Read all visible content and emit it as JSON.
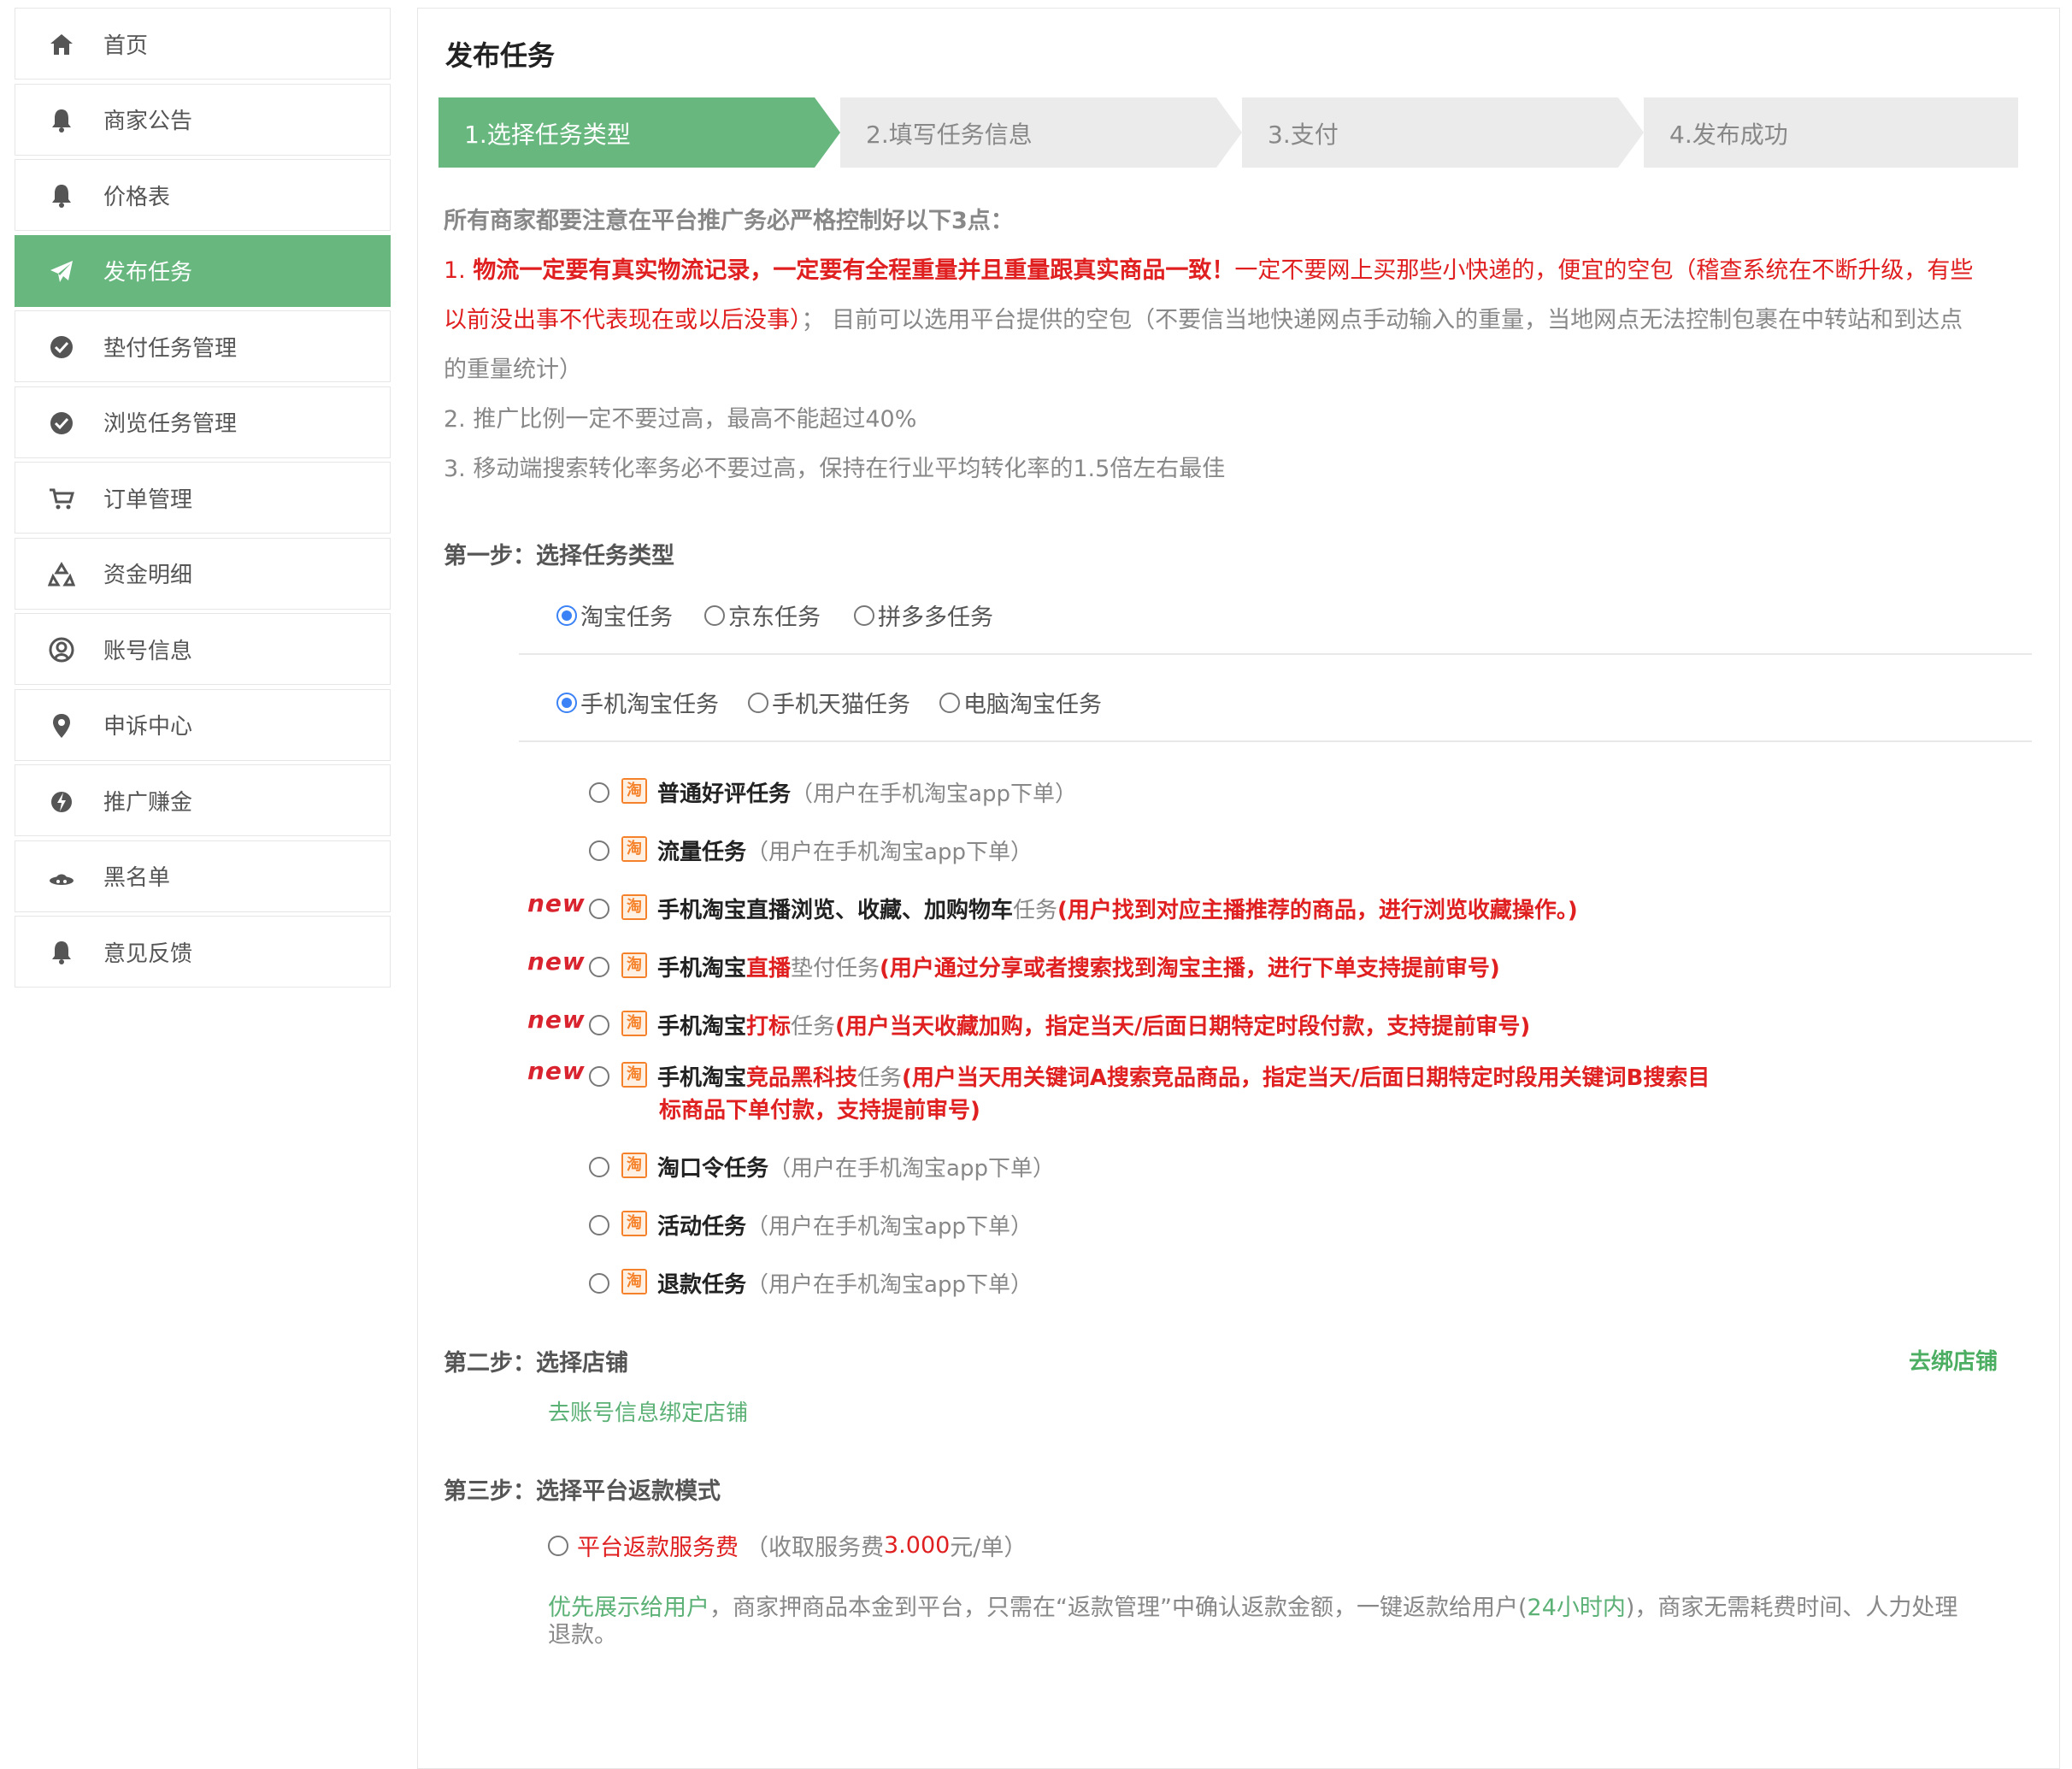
{
  "sidebar": {
    "items": [
      {
        "label": "首页",
        "icon": "home-icon",
        "active": false
      },
      {
        "label": "商家公告",
        "icon": "bell-icon",
        "active": false
      },
      {
        "label": "价格表",
        "icon": "bell-icon",
        "active": false
      },
      {
        "label": "发布任务",
        "icon": "paper-plane-icon",
        "active": true
      },
      {
        "label": "垫付任务管理",
        "icon": "check-circle-icon",
        "active": false
      },
      {
        "label": "浏览任务管理",
        "icon": "check-circle-icon",
        "active": false
      },
      {
        "label": "订单管理",
        "icon": "cart-icon",
        "active": false
      },
      {
        "label": "资金明细",
        "icon": "recycle-icon",
        "active": false
      },
      {
        "label": "账号信息",
        "icon": "user-circle-icon",
        "active": false
      },
      {
        "label": "申诉中心",
        "icon": "map-pin-icon",
        "active": false
      },
      {
        "label": "推广赚金",
        "icon": "bolt-icon",
        "active": false
      },
      {
        "label": "黑名单",
        "icon": "hat-icon",
        "active": false
      },
      {
        "label": "意见反馈",
        "icon": "bell-icon",
        "active": false
      }
    ]
  },
  "main": {
    "title": "发布任务",
    "steps": [
      {
        "label": "1.选择任务类型",
        "active": true
      },
      {
        "label": "2.填写任务信息",
        "active": false
      },
      {
        "label": "3.支付",
        "active": false
      },
      {
        "label": "4.发布成功",
        "active": false
      }
    ],
    "notice": {
      "heading": "所有商家都要注意在平台推广务必严格控制好以下3点：",
      "p1_num": "1. ",
      "p1_red_bold": "物流一定要有真实物流记录，一定要有全程重量并且重量跟真实商品一致！",
      "p1_red_a": "一定不要网上买那些小快递的，便宜的空包（稽查系统在不断升级，有些",
      "p1_red_b": "以前没出事不代表现在或以后没事）",
      "p1_grey_b": "；  目前可以选用平台提供的空包（不要信当地快递网点手动输入的重量，当地网点无法控制包裹在中转站和到达点",
      "p1_grey_c": "的重量统计）",
      "p2": "2. 推广比例一定不要过高，最高不能超过40%",
      "p3": "3. 移动端搜索转化率务必不要过高，保持在行业平均转化率的1.5倍左右最佳"
    },
    "step1": {
      "title": "第一步：选择任务类型",
      "platforms": [
        {
          "label": "淘宝任务",
          "checked": true
        },
        {
          "label": "京东任务",
          "checked": false
        },
        {
          "label": "拼多多任务",
          "checked": false
        }
      ],
      "subtypes": [
        {
          "label": "手机淘宝任务",
          "checked": true
        },
        {
          "label": "手机天猫任务",
          "checked": false
        },
        {
          "label": "电脑淘宝任务",
          "checked": false
        }
      ],
      "new_label": "new",
      "tasks": [
        {
          "name": "普通好评任务",
          "desc": "（用户在手机淘宝app下单）"
        },
        {
          "name": "流量任务",
          "desc": "（用户在手机淘宝app下单）"
        },
        {
          "name_a": "手机淘宝直播浏览、收藏、加购物车",
          "name_b": "任务",
          "desc": "(用户找到对应主播推荐的商品，进行浏览收藏操作。)"
        },
        {
          "name_a": "手机淘宝",
          "name_red": "直播",
          "name_b": "垫付任务",
          "desc": "(用户通过分享或者搜索找到淘宝主播，进行下单支持提前审号)"
        },
        {
          "name_a": "手机淘宝",
          "name_red": "打标",
          "name_b": "任务",
          "desc": "(用户当天收藏加购，指定当天/后面日期特定时段付款，支持提前审号)"
        },
        {
          "name_a": "手机淘宝",
          "name_red": "竞品黑科技",
          "name_b": "任务",
          "desc": "(用户当天用关键词A搜索竞品商品，指定当天/后面日期特定时段用关键词B搜索目",
          "desc2": "标商品下单付款，支持提前审号)"
        },
        {
          "name": "淘口令任务",
          "desc": " （用户在手机淘宝app下单）"
        },
        {
          "name": "活动任务",
          "desc": " （用户在手机淘宝app下单）"
        },
        {
          "name": "退款任务",
          "desc": "（用户在手机淘宝app下单）"
        }
      ]
    },
    "step2": {
      "title": "第二步：选择店铺",
      "bind_link": "去绑店铺",
      "account_link": "去账号信息绑定店铺"
    },
    "step3": {
      "title": "第三步：选择平台返款模式",
      "option_label": "平台返款服务费",
      "fee_prefix": "（收取服务费 ",
      "fee_value": "3.000",
      "fee_suffix": " 元/单）",
      "desc_green_a": "优先展示给用户",
      "desc_grey_a": "，商家押商品本金到平台，只需在“返款管理”中确认返款金额，一键返款给用户(",
      "desc_green_b": "24小时内",
      "desc_grey_b": ")，商家无需耗费时间、人力处理",
      "desc_grey_c": "退款。"
    }
  },
  "colors": {
    "accent_green": "#67b77f",
    "text_red": "#e02020",
    "radio_blue": "#3b82f6",
    "taobao_orange": "#f5822a"
  }
}
